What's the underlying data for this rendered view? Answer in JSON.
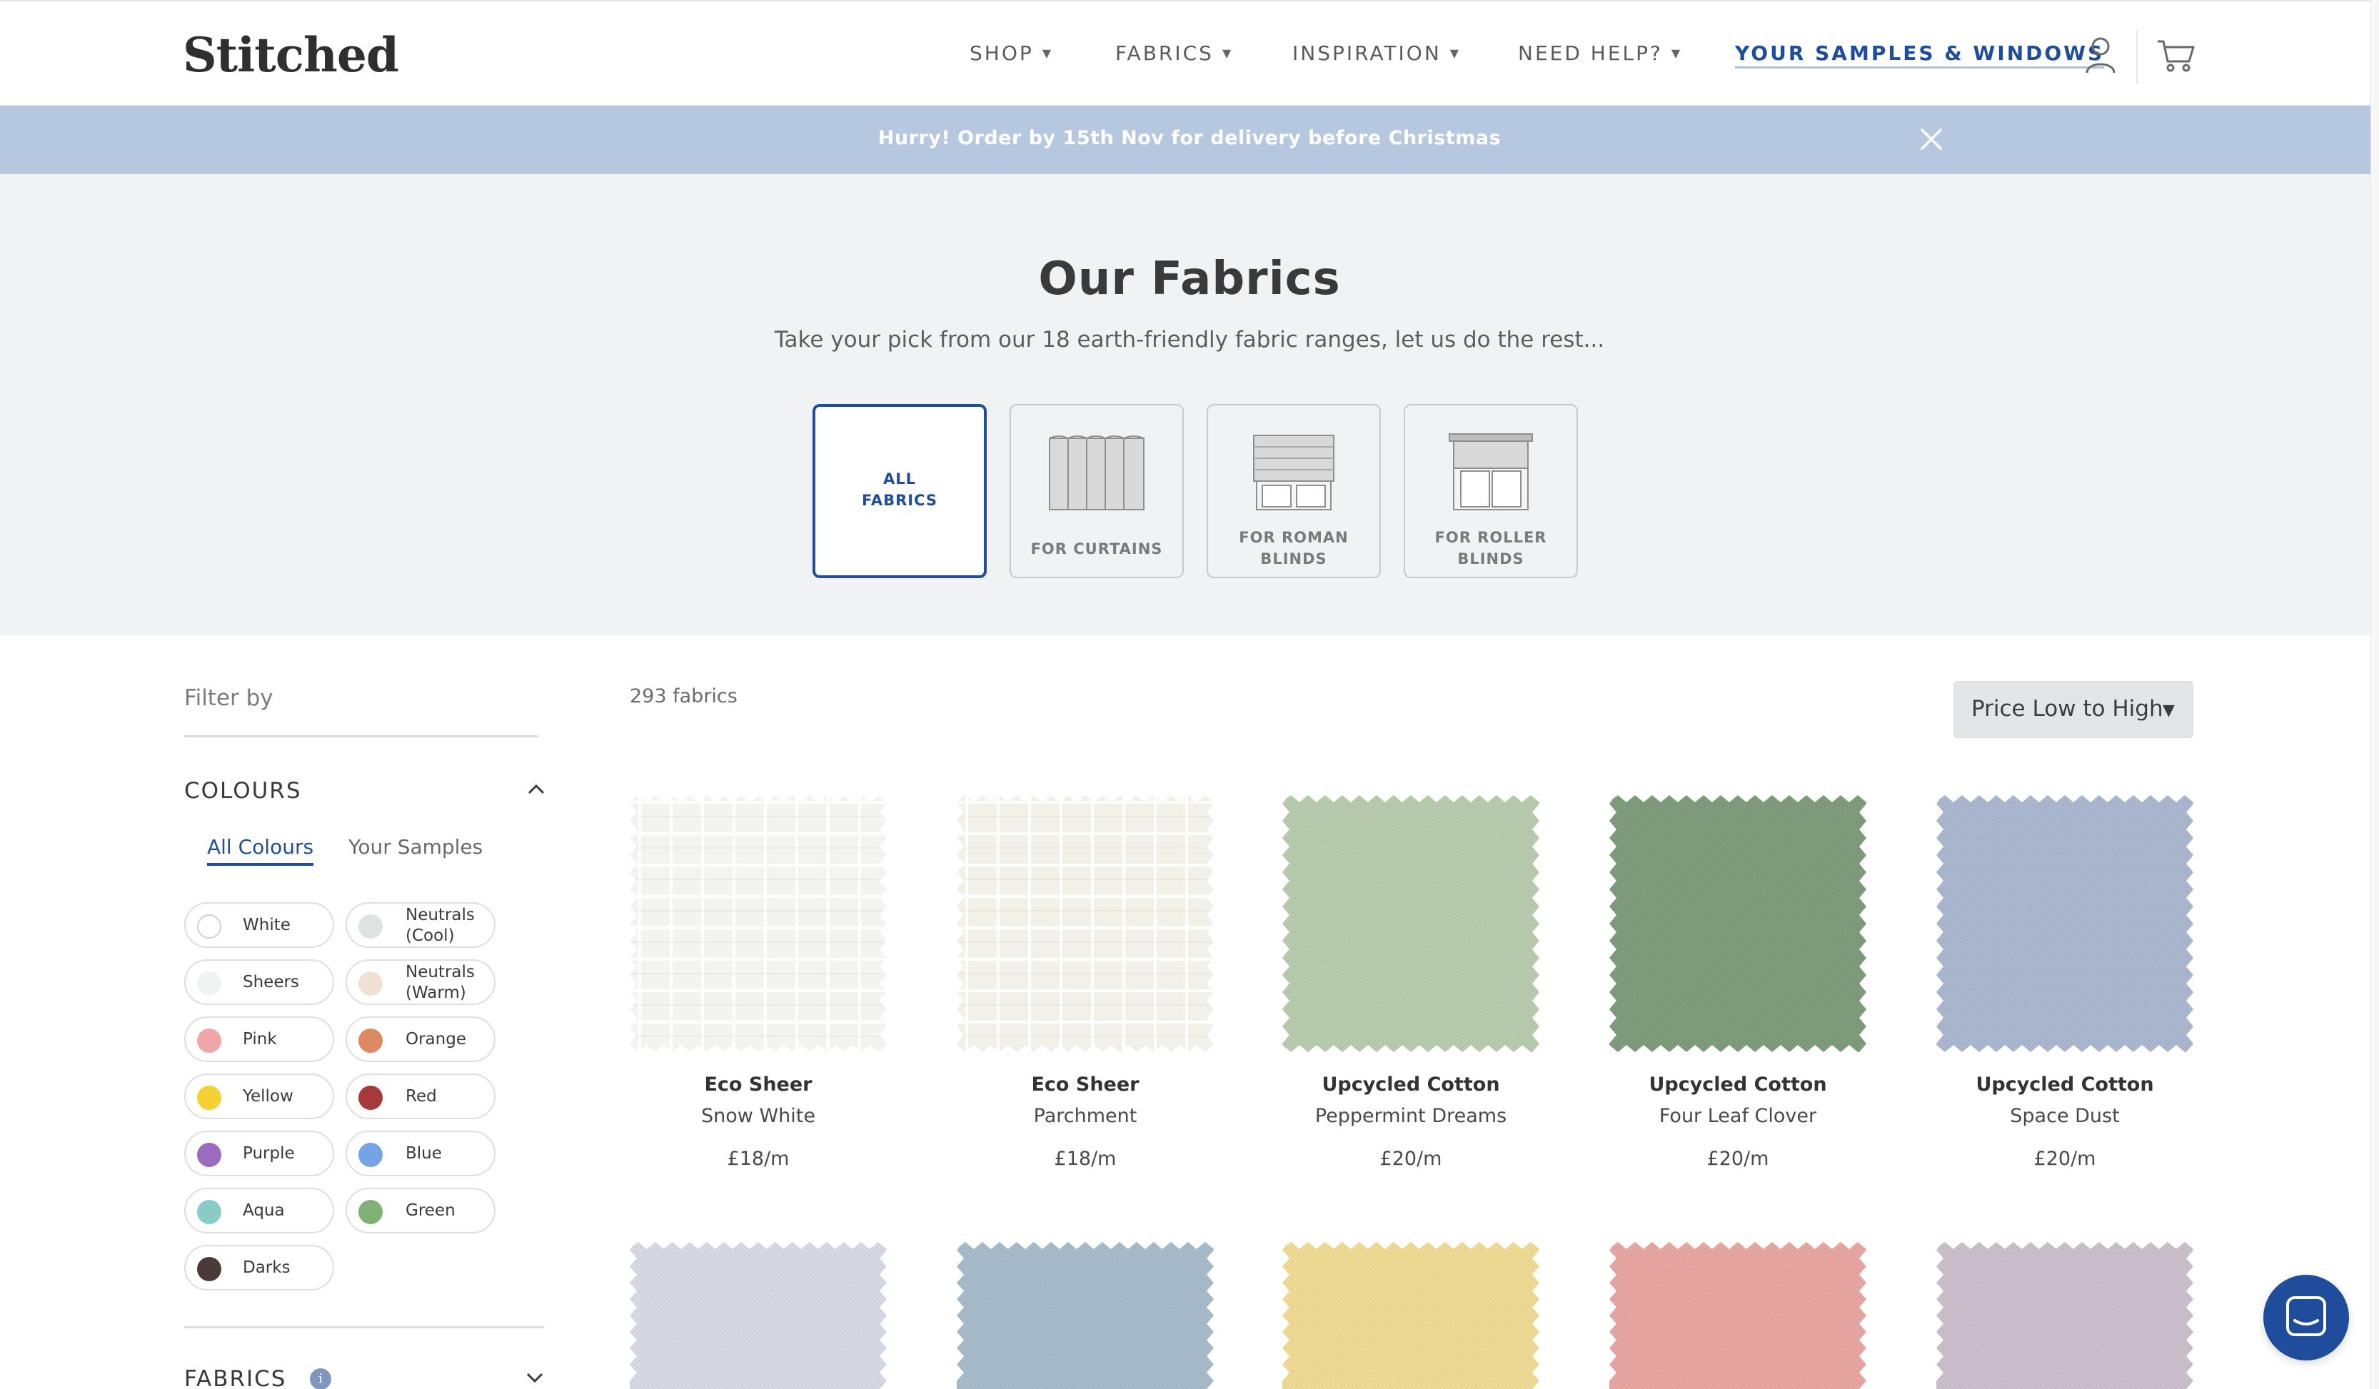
{
  "header": {
    "logo": "Stitched",
    "nav": [
      {
        "label": "SHOP",
        "has_caret": true
      },
      {
        "label": "FABRICS",
        "has_caret": true
      },
      {
        "label": "INSPIRATION",
        "has_caret": true
      },
      {
        "label": "NEED HELP?",
        "has_caret": true
      }
    ],
    "samples_link": "YOUR SAMPLES & WINDOWS",
    "icons": [
      "user-icon",
      "cart-icon"
    ]
  },
  "banner": {
    "text": "Hurry! Order by 15th Nov for delivery before Christmas",
    "close_icon": "close-icon",
    "background": "#b6c8e0"
  },
  "hero": {
    "title": "Our Fabrics",
    "subtitle": "Take your pick from our 18 earth-friendly fabric ranges, let us do the rest...",
    "categories": [
      {
        "label": "ALL\nFABRICS",
        "active": true,
        "icon": null
      },
      {
        "label": "FOR CURTAINS",
        "active": false,
        "icon": "curtain-icon"
      },
      {
        "label": "FOR ROMAN\nBLINDS",
        "active": false,
        "icon": "roman-blind-icon"
      },
      {
        "label": "FOR ROLLER\nBLINDS",
        "active": false,
        "icon": "roller-blind-icon"
      }
    ]
  },
  "sidebar": {
    "filter_by": "Filter by",
    "colours": {
      "heading": "COLOURS",
      "tabs": [
        {
          "label": "All Colours",
          "active": true
        },
        {
          "label": "Your Samples",
          "active": false
        }
      ],
      "chips": [
        {
          "label": "White",
          "color": "#ffffff"
        },
        {
          "label": "Neutrals\n(Cool)",
          "color": "#dde3e3"
        },
        {
          "label": "Sheers",
          "color": "#f1f2f2"
        },
        {
          "label": "Neutrals\n(Warm)",
          "color": "#efe1d3"
        },
        {
          "label": "Pink",
          "color": "#eea6a6"
        },
        {
          "label": "Orange",
          "color": "#dd8a63"
        },
        {
          "label": "Yellow",
          "color": "#f5d134"
        },
        {
          "label": "Red",
          "color": "#a6393a"
        },
        {
          "label": "Purple",
          "color": "#9a6bbf"
        },
        {
          "label": "Blue",
          "color": "#76a3e6"
        },
        {
          "label": "Aqua",
          "color": "#88ccc5"
        },
        {
          "label": "Green",
          "color": "#80b278"
        },
        {
          "label": "Darks",
          "color": "#4a3a38"
        }
      ]
    },
    "fabrics": {
      "heading": "FABRICS",
      "info_icon": "info-icon"
    }
  },
  "products": {
    "count": "293 fabrics",
    "sort": {
      "selected": "Price Low to High"
    },
    "items": [
      {
        "name": "Eco Sheer",
        "colour": "Snow White",
        "price": "£18/m",
        "swatch": "#f3f3f1",
        "sheer": true
      },
      {
        "name": "Eco Sheer",
        "colour": "Parchment",
        "price": "£18/m",
        "swatch": "#f1f1ea",
        "sheer": true
      },
      {
        "name": "Upcycled Cotton",
        "colour": "Peppermint Dreams",
        "price": "£20/m",
        "swatch": "#b9ccae",
        "sheer": false
      },
      {
        "name": "Upcycled Cotton",
        "colour": "Four Leaf Clover",
        "price": "£20/m",
        "swatch": "#7f9d7d",
        "sheer": false
      },
      {
        "name": "Upcycled Cotton",
        "colour": "Space Dust",
        "price": "£20/m",
        "swatch": "#acb7d0",
        "sheer": false
      }
    ],
    "row2_swatches": [
      "#d8dae6",
      "#a8bccc",
      "#f0dc94",
      "#e8a7a2",
      "#cbc0cc"
    ]
  },
  "chat": {
    "icon": "chat-icon",
    "color": "#1f4d9c"
  }
}
